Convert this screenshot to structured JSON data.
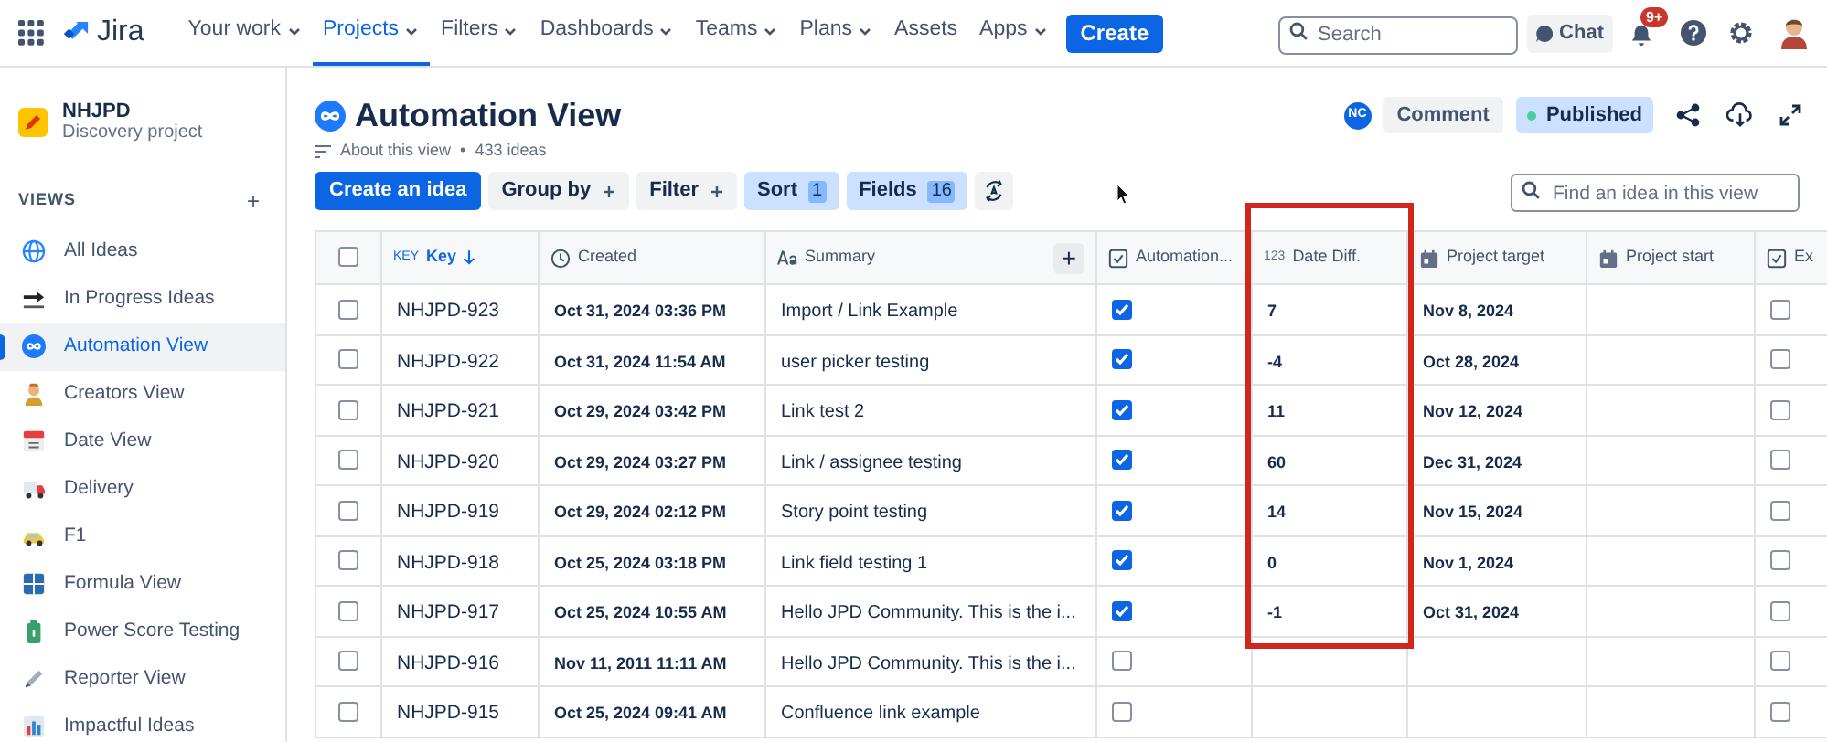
{
  "nav": {
    "product": "Jira",
    "items": [
      {
        "label": "Your work",
        "dropdown": true,
        "selected": false
      },
      {
        "label": "Projects",
        "dropdown": true,
        "selected": true
      },
      {
        "label": "Filters",
        "dropdown": true,
        "selected": false
      },
      {
        "label": "Dashboards",
        "dropdown": true,
        "selected": false
      },
      {
        "label": "Teams",
        "dropdown": true,
        "selected": false
      },
      {
        "label": "Plans",
        "dropdown": true,
        "selected": false
      },
      {
        "label": "Assets",
        "dropdown": false,
        "selected": false
      },
      {
        "label": "Apps",
        "dropdown": true,
        "selected": false
      }
    ],
    "create": "Create",
    "search": {
      "placeholder": "Search"
    },
    "chat": "Chat",
    "notifications": "9+"
  },
  "sidebar": {
    "project": {
      "name": "NHJPD",
      "type": "Discovery project"
    },
    "section": "VIEWS",
    "add": "+",
    "items": [
      {
        "label": "All Ideas",
        "kind": "globe",
        "selected": false
      },
      {
        "label": "In Progress Ideas",
        "kind": "soon",
        "selected": false
      },
      {
        "label": "Automation View",
        "kind": "infinity",
        "selected": true
      },
      {
        "label": "Creators View",
        "kind": "person",
        "selected": false
      },
      {
        "label": "Date View",
        "kind": "calendar",
        "selected": false
      },
      {
        "label": "Delivery",
        "kind": "truck",
        "selected": false
      },
      {
        "label": "F1",
        "kind": "car",
        "selected": false
      },
      {
        "label": "Formula View",
        "kind": "numbers",
        "selected": false
      },
      {
        "label": "Power Score Testing",
        "kind": "battery",
        "selected": false
      },
      {
        "label": "Reporter View",
        "kind": "pen",
        "selected": false
      },
      {
        "label": "Impactful Ideas",
        "kind": "chart",
        "selected": false
      }
    ]
  },
  "view": {
    "title": "Automation View",
    "about": "About this view",
    "separator": "•",
    "count": "433 ideas",
    "avatar": "NC",
    "comment": "Comment",
    "status": "Published",
    "toolbar": [
      {
        "label": "Create an idea",
        "kind": "primary"
      },
      {
        "label": "Group by",
        "kind": "plus"
      },
      {
        "label": "Filter",
        "kind": "plus"
      },
      {
        "label": "Sort",
        "kind": "count",
        "count": "1"
      },
      {
        "label": "Fields",
        "kind": "count",
        "count": "16"
      }
    ],
    "find": {
      "placeholder": "Find an idea in this view"
    }
  },
  "table": {
    "all_selected": false,
    "columns": [
      {
        "label": "Key",
        "tag": "KEY",
        "kind": "key",
        "sorted": true,
        "highlighted": false
      },
      {
        "label": "Created",
        "kind": "clock",
        "sorted": false,
        "highlighted": false
      },
      {
        "label": "Summary",
        "kind": "text",
        "sorted": false,
        "highlighted": false
      },
      {
        "label": "Automation...",
        "kind": "check",
        "sorted": false,
        "highlighted": false
      },
      {
        "label": "Date Diff.",
        "tag": "123",
        "kind": "number",
        "sorted": false,
        "highlighted": true
      },
      {
        "label": "Project target",
        "kind": "date",
        "sorted": false,
        "highlighted": false
      },
      {
        "label": "Project start",
        "kind": "date",
        "sorted": false,
        "highlighted": false
      },
      {
        "label": "Ex",
        "kind": "check",
        "sorted": false,
        "highlighted": false
      }
    ],
    "add_column": "+",
    "rows": [
      {
        "selected": false,
        "key": "NHJPD-923",
        "created": "Oct 31, 2024 03:36 PM",
        "summary": "Import / Link Example",
        "automation": true,
        "date_diff": "7",
        "project_target": "Nov 8, 2024",
        "ex": false,
        "highlighted": true
      },
      {
        "selected": false,
        "key": "NHJPD-922",
        "created": "Oct 31, 2024 11:54 AM",
        "summary": "user picker testing",
        "automation": true,
        "date_diff": "-4",
        "project_target": "Oct 28, 2024",
        "ex": false,
        "highlighted": true
      },
      {
        "selected": false,
        "key": "NHJPD-921",
        "created": "Oct 29, 2024 03:42 PM",
        "summary": "Link test 2",
        "automation": true,
        "date_diff": "11",
        "project_target": "Nov 12, 2024",
        "ex": false,
        "highlighted": true
      },
      {
        "selected": false,
        "key": "NHJPD-920",
        "created": "Oct 29, 2024 03:27 PM",
        "summary": "Link / assignee testing",
        "automation": true,
        "date_diff": "60",
        "project_target": "Dec 31, 2024",
        "ex": false,
        "highlighted": true
      },
      {
        "selected": false,
        "key": "NHJPD-919",
        "created": "Oct 29, 2024 02:12 PM",
        "summary": "Story point testing",
        "automation": true,
        "date_diff": "14",
        "project_target": "Nov 15, 2024",
        "ex": false,
        "highlighted": true
      },
      {
        "selected": false,
        "key": "NHJPD-918",
        "created": "Oct 25, 2024 03:18 PM",
        "summary": "Link field testing 1",
        "automation": true,
        "date_diff": "0",
        "project_target": "Nov 1, 2024",
        "ex": false,
        "highlighted": true
      },
      {
        "selected": false,
        "key": "NHJPD-917",
        "created": "Oct 25, 2024 10:55 AM",
        "summary": "Hello JPD Community. This is the i...",
        "automation": true,
        "date_diff": "-1",
        "project_target": "Oct 31, 2024",
        "ex": false,
        "highlighted": true
      },
      {
        "selected": false,
        "key": "NHJPD-916",
        "created": "Nov 11, 2011 11:11 AM",
        "summary": "Hello JPD Community. This is the i...",
        "automation": false,
        "ex": false,
        "highlighted": false
      },
      {
        "selected": false,
        "key": "NHJPD-915",
        "created": "Oct 25, 2024 09:41 AM",
        "summary": "Confluence link example",
        "automation": false,
        "ex": false,
        "highlighted": false
      }
    ]
  }
}
